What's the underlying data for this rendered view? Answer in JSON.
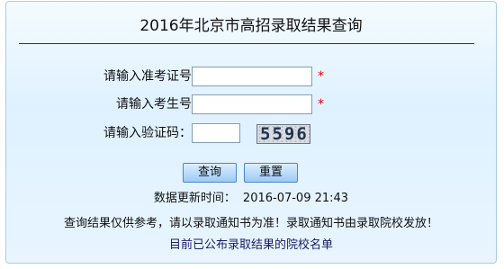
{
  "title": "2016年北京市高招录取结果查询",
  "form": {
    "exam_id_label": "请输入准考证号",
    "exam_id_value": "",
    "name_label": "请输入考生号",
    "name_value": "",
    "captcha_label": "请输入验证码：",
    "captcha_value": "",
    "captcha_image_text": "5596",
    "required_mark": "*"
  },
  "buttons": {
    "query": "查询",
    "reset": "重置"
  },
  "update": {
    "label": "数据更新时间：",
    "time": "2016-07-09 21:43"
  },
  "notice": "查询结果仅供参考，请以录取通知书为准！录取通知书由录取院校发放！",
  "link": "目前已公布录取结果的院校名单"
}
